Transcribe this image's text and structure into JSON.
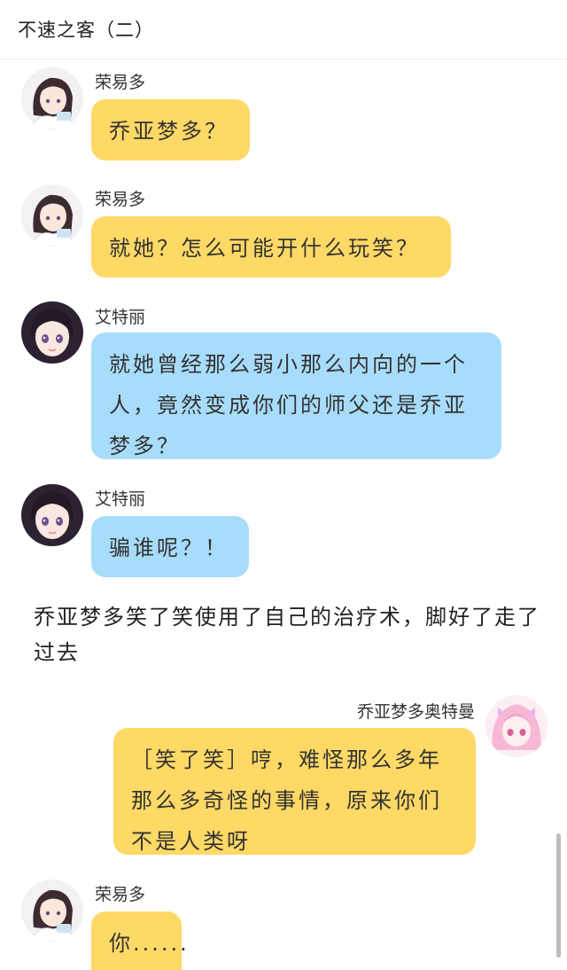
{
  "header": {
    "title": "不速之客（二）"
  },
  "messages": [
    {
      "speaker": "荣易多",
      "text": "乔亚梦多？"
    },
    {
      "speaker": "荣易多",
      "text": "就她？怎么可能开什么玩笑？"
    },
    {
      "speaker": "艾特丽",
      "text": "就她曾经那么弱小那么内向的一个人，竟然变成你们的师父还是乔亚梦多？"
    },
    {
      "speaker": "艾特丽",
      "text": "骗谁呢？！"
    },
    {
      "speaker": "乔亚梦多奥特曼",
      "text": "［笑了笑］哼，难怪那么多年那么多奇怪的事情，原来你们不是人类呀"
    },
    {
      "speaker": "荣易多",
      "text": "你......"
    }
  ],
  "narration": "乔亚梦多笑了笑使用了自己的治疗术，脚好了走了过去",
  "colors": {
    "yellow_bubble": "#ffd966",
    "blue_bubble": "#a8dcfb"
  }
}
